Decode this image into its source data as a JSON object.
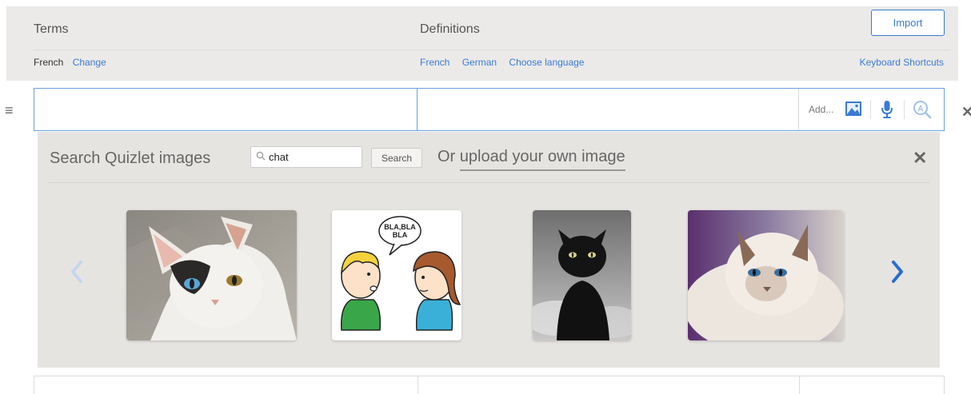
{
  "header": {
    "terms_label": "Terms",
    "definitions_label": "Definitions",
    "import_label": "Import",
    "terms_language": "French",
    "terms_change": "Change",
    "def_languages": [
      "French",
      "German",
      "Choose language"
    ],
    "keyboard_shortcuts": "Keyboard Shortcuts"
  },
  "row": {
    "term_value": "",
    "definition_value": "",
    "add_label": "Add..."
  },
  "image_search": {
    "title": "Search Quizlet images",
    "query": "chat",
    "search_button": "Search",
    "upload_prefix": "Or ",
    "upload_link": "upload your own image",
    "results": [
      {
        "name": "white-cat-image"
      },
      {
        "name": "two-kids-chatting-image",
        "speech_text": "BLA,BLA BLA"
      },
      {
        "name": "black-cat-image"
      },
      {
        "name": "fluffy-cat-image"
      }
    ]
  },
  "colors": {
    "accent": "#3a7ad5",
    "panel_bg": "#e6e4e1",
    "header_bg": "#ebeae8"
  }
}
